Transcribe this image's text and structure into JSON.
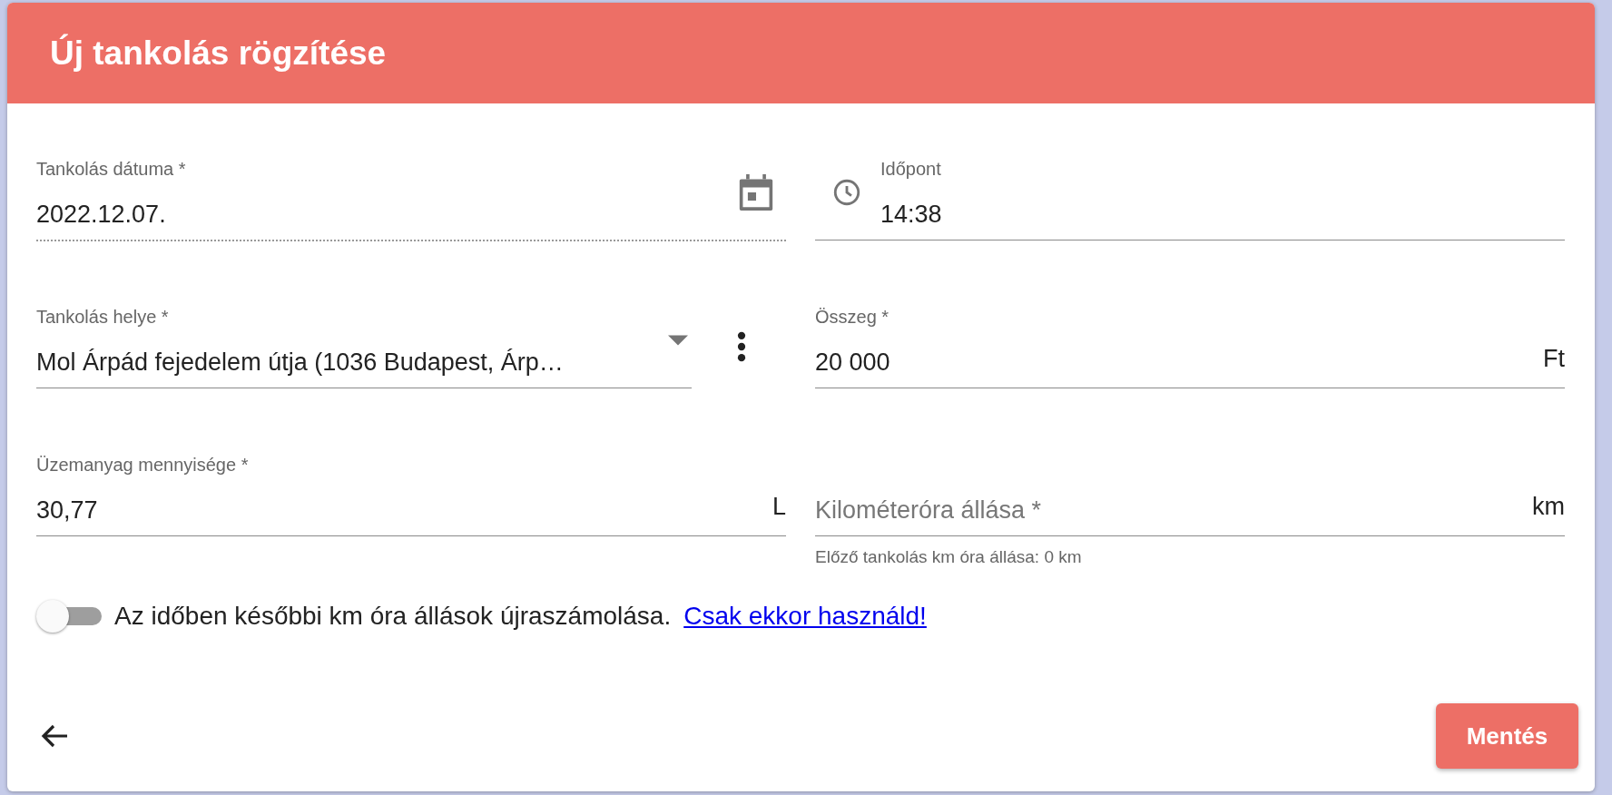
{
  "dialog": {
    "title": "Új tankolás rögzítése"
  },
  "fields": [
    {
      "kind": "date",
      "label": "Tankolás dátuma *",
      "value": "2022.12.07."
    },
    {
      "kind": "time",
      "label": "Időpont",
      "value": "14:38"
    },
    {
      "kind": "select",
      "label": "Tankolás helye *",
      "value": "Mol Árpád fejedelem útja (1036 Budapest, Árp…"
    },
    {
      "kind": "number",
      "label": "Összeg *",
      "value": "20 000",
      "suffix": "Ft"
    },
    {
      "kind": "number",
      "label": "Üzemanyag mennyisége *",
      "value": "30,77",
      "suffix": "L"
    },
    {
      "kind": "number",
      "placeholder": "Kilométeróra állása *",
      "suffix": "km",
      "hint": "Előző tankolás km óra állása: 0 km"
    }
  ],
  "toggle": {
    "on": false,
    "label": "Az időben későbbi km óra állások újraszámolása.",
    "link": "Csak ekkor használd!"
  },
  "footer": {
    "save_label": "Mentés"
  }
}
